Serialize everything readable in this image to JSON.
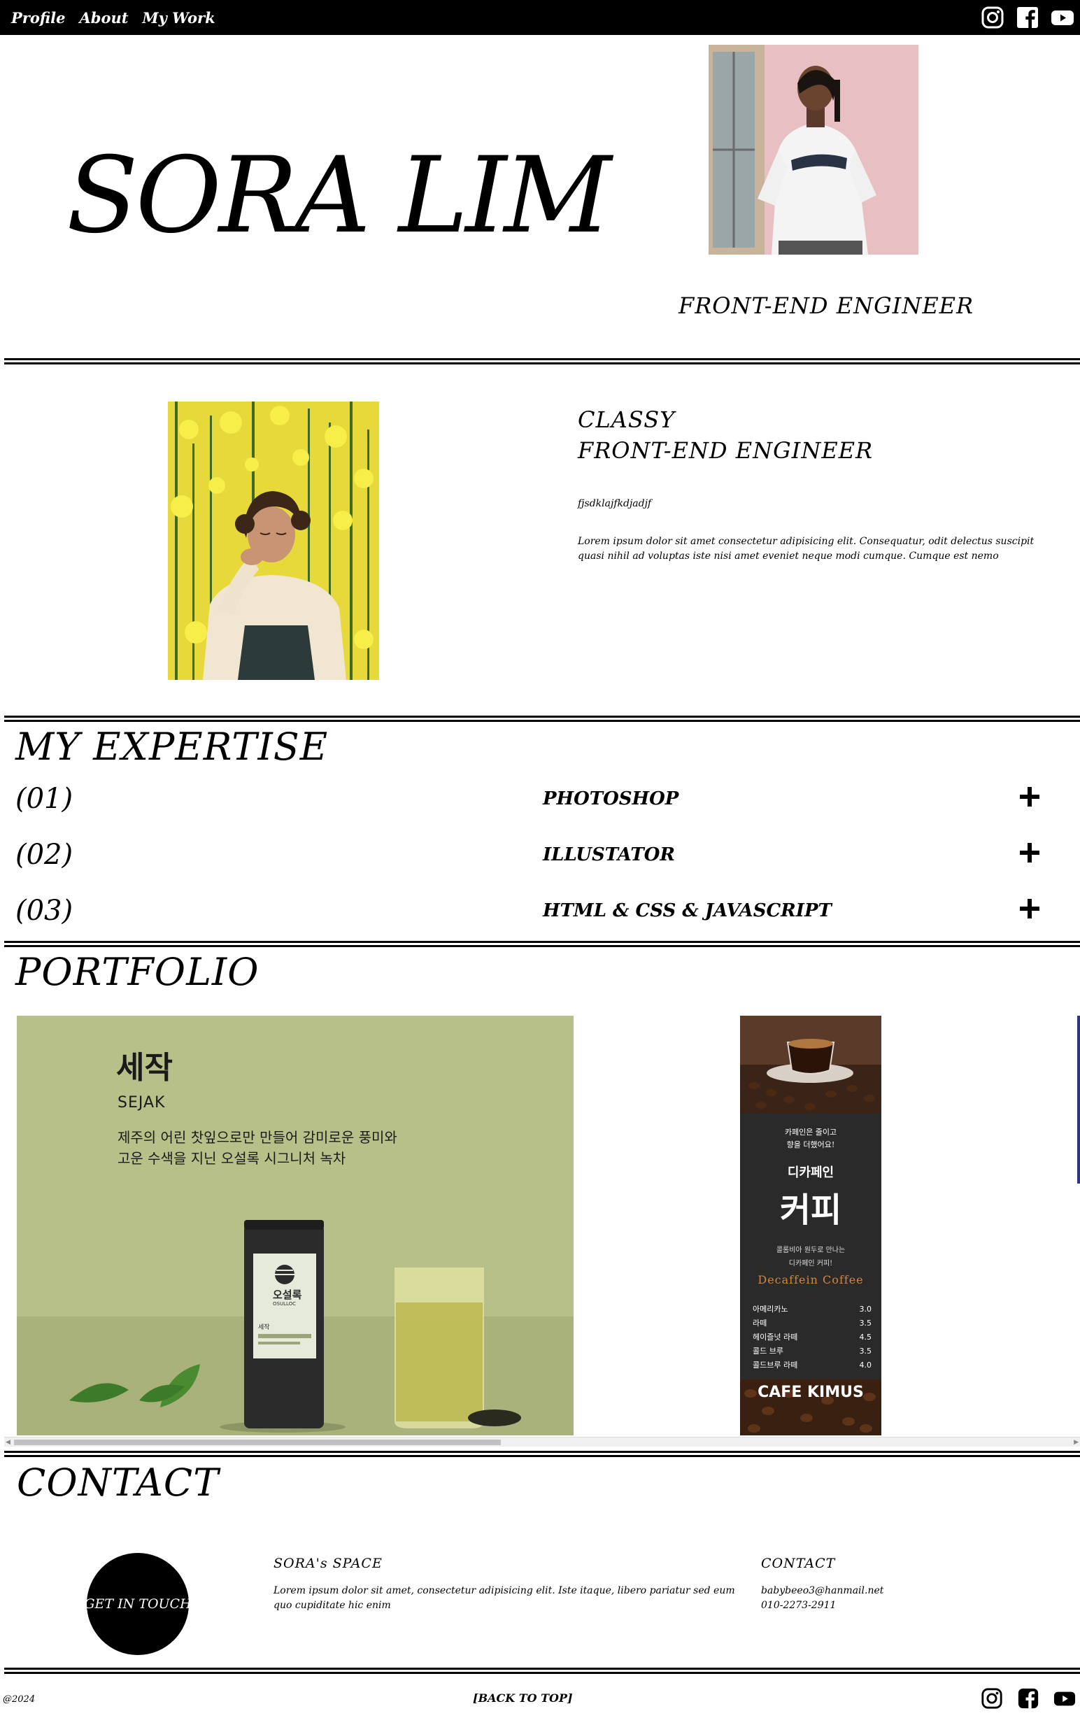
{
  "nav": {
    "links": [
      "Profile",
      "About",
      "My Work"
    ],
    "icons": [
      "instagram-icon",
      "facebook-icon",
      "youtube-icon"
    ]
  },
  "hero": {
    "name": "SORA LIM",
    "role": "FRONT-END ENGINEER"
  },
  "about": {
    "title_line1": "CLASSY",
    "title_line2": "FRONT-END ENGINEER",
    "subtitle": "fjsdklajfkdjadjf",
    "text": "Lorem ipsum dolor sit amet consectetur adipisicing elit. Consequatur, odit delectus suscipit quasi nihil ad voluptas iste nisi amet eveniet neque modi cumque. Cumque est nemo"
  },
  "expertise": {
    "title": "MY EXPERTISE",
    "items": [
      {
        "num": "(01)",
        "name": "PHOTOSHOP"
      },
      {
        "num": "(02)",
        "name": "ILLUSTATOR"
      },
      {
        "num": "(03)",
        "name": "HTML & CSS & JAVASCRIPT"
      }
    ]
  },
  "portfolio": {
    "title": "PORTFOLIO",
    "card1": {
      "logo": "세작",
      "brand": "SEJAK",
      "line1": "제주의 어린 찻잎으로만 만들어 감미로운 풍미와",
      "line2": "고운 수색을 지닌 오설록 시그니처 녹차",
      "can_brand": "오설록",
      "can_sub": "OSULLOC",
      "can_label": "세작"
    },
    "card2": {
      "tagline1": "카페인은 줄이고",
      "tagline2": "향을 더했어요!",
      "heading_small": "디카페인",
      "heading_big": "커피",
      "desc1": "콜롬비아 원두로 만나는",
      "desc2": "디카페인 커피!",
      "english": "Decaffein Coffee",
      "menu": [
        {
          "item": "아메리카노",
          "price": "3.0"
        },
        {
          "item": "라떼",
          "price": "3.5"
        },
        {
          "item": "헤이즐넛 라떼",
          "price": "4.5"
        },
        {
          "item": "콜드 브루",
          "price": "3.5"
        },
        {
          "item": "콜드브루 라떼",
          "price": "4.0"
        }
      ],
      "cafe": "CAFE KIMUS"
    }
  },
  "contact": {
    "title": "CONTACT",
    "button": "GET IN TOUCH",
    "space_title": "SORA's SPACE",
    "space_text": "Lorem ipsum dolor sit amet, consectetur adipisicing elit. Iste itaque, libero pariatur sed eum quo cupiditate hic enim",
    "contact_title": "CONTACT",
    "email": "babybeeo3@hanmail.net",
    "phone": "010-2273-2911"
  },
  "footer": {
    "copyright": "@2024",
    "back": "[BACK TO TOP]",
    "icons": [
      "instagram-icon",
      "facebook-icon",
      "youtube-icon"
    ]
  },
  "colors": {
    "black": "#000000",
    "tea_bg": "#b8c08a",
    "coffee_bg": "#2a2a2a",
    "decaf_accent": "#d2873e"
  }
}
